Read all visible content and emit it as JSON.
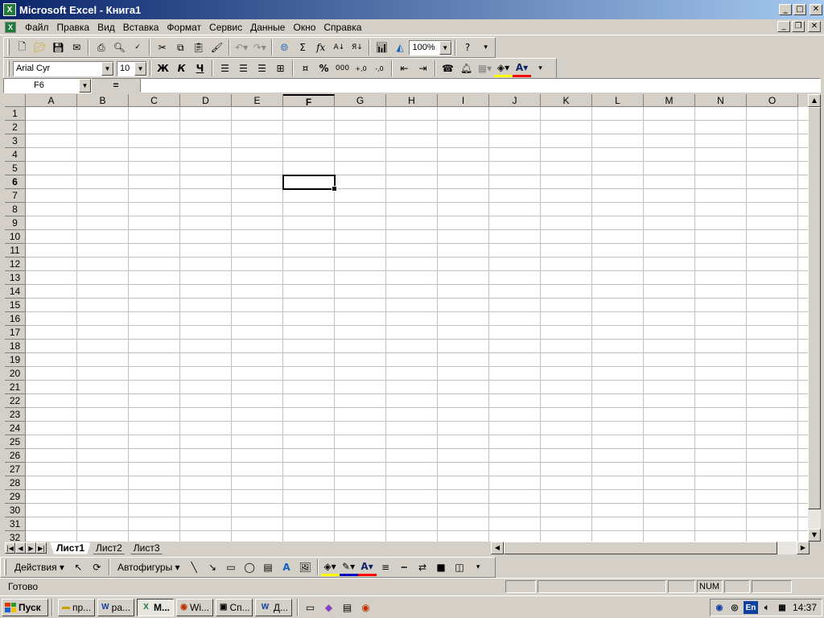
{
  "window": {
    "title": "Microsoft Excel - Книга1",
    "app_icon": "excel-icon"
  },
  "menu": [
    "Файл",
    "Правка",
    "Вид",
    "Вставка",
    "Формат",
    "Сервис",
    "Данные",
    "Окно",
    "Справка"
  ],
  "standard_toolbar": {
    "zoom": "100%"
  },
  "format_toolbar": {
    "font": "Arial Cyr",
    "size": "10",
    "bold": "Ж",
    "italic": "К",
    "underline": "Ч",
    "percent": "%",
    "thousands": "000",
    "font_color": "#ff0000",
    "fill_color": "#ffff00"
  },
  "formula_bar": {
    "name_box": "F6",
    "equals": "=",
    "value": ""
  },
  "grid": {
    "columns": [
      "A",
      "B",
      "C",
      "D",
      "E",
      "F",
      "G",
      "H",
      "I",
      "J",
      "K",
      "L",
      "M",
      "N",
      "O"
    ],
    "rows": [
      "1",
      "2",
      "3",
      "4",
      "5",
      "6",
      "7",
      "8",
      "9",
      "10",
      "11",
      "12",
      "13",
      "14",
      "15",
      "16",
      "17",
      "18",
      "19",
      "20",
      "21",
      "22",
      "23",
      "24",
      "25",
      "26",
      "27",
      "28",
      "29",
      "30",
      "31",
      "32"
    ],
    "active_cell": "F6"
  },
  "sheets": [
    "Лист1",
    "Лист2",
    "Лист3"
  ],
  "active_sheet": "Лист1",
  "draw_toolbar": {
    "actions": "Действия",
    "autoshapes": "Автофигуры"
  },
  "status": {
    "text": "Готово",
    "num": "NUM"
  },
  "taskbar": {
    "start": "Пуск",
    "items": [
      {
        "label": "пр...",
        "icon": "folder-icon"
      },
      {
        "label": "ра...",
        "icon": "word-icon"
      },
      {
        "label": "M...",
        "icon": "excel-icon"
      },
      {
        "label": "Wi...",
        "icon": "browser-icon"
      },
      {
        "label": "Сп...",
        "icon": "app-icon"
      },
      {
        "label": "Д...",
        "icon": "word-icon"
      }
    ],
    "tray_lang": "En",
    "clock": "14:37"
  }
}
